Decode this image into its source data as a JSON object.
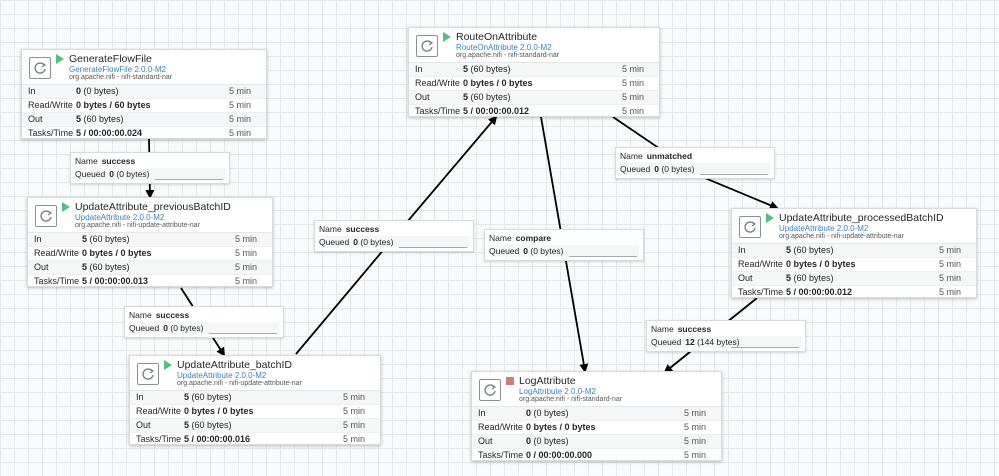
{
  "processors": {
    "gen": {
      "name": "GenerateFlowFile",
      "version": "GenerateFlowFile 2.0.0-M2",
      "bundle": "org.apache.nifi - nifi-standard-nar",
      "state": "running",
      "in_label": "In",
      "in_count": "0",
      "in_bytes": "(0 bytes)",
      "in_time": "5 min",
      "rw_label": "Read/Write",
      "rw_value": "0 bytes / 60 bytes",
      "rw_time": "5 min",
      "out_label": "Out",
      "out_count": "5",
      "out_bytes": "(60 bytes)",
      "out_time": "5 min",
      "tasks_label": "Tasks/Time",
      "tasks_value": "5 / 00:00:00.024",
      "tasks_time": "5 min"
    },
    "prev": {
      "name": "UpdateAttribute_previousBatchID",
      "version": "UpdateAttribute 2.0.0-M2",
      "bundle": "org.apache.nifi - nifi-update-attribute-nar",
      "state": "running",
      "in_label": "In",
      "in_count": "5",
      "in_bytes": "(60 bytes)",
      "in_time": "5 min",
      "rw_label": "Read/Write",
      "rw_value": "0 bytes / 0 bytes",
      "rw_time": "5 min",
      "out_label": "Out",
      "out_count": "5",
      "out_bytes": "(60 bytes)",
      "out_time": "5 min",
      "tasks_label": "Tasks/Time",
      "tasks_value": "5 / 00:00:00.013",
      "tasks_time": "5 min"
    },
    "batch": {
      "name": "UpdateAttribute_batchID",
      "version": "UpdateAttribute 2.0.0-M2",
      "bundle": "org.apache.nifi - nifi-update-attribute-nar",
      "state": "running",
      "in_label": "In",
      "in_count": "5",
      "in_bytes": "(60 bytes)",
      "in_time": "5 min",
      "rw_label": "Read/Write",
      "rw_value": "0 bytes / 0 bytes",
      "rw_time": "5 min",
      "out_label": "Out",
      "out_count": "5",
      "out_bytes": "(60 bytes)",
      "out_time": "5 min",
      "tasks_label": "Tasks/Time",
      "tasks_value": "5 / 00:00:00.016",
      "tasks_time": "5 min"
    },
    "route": {
      "name": "RouteOnAttribute",
      "version": "RouteOnAttribute 2.0.0-M2",
      "bundle": "org.apache.nifi - nifi-standard-nar",
      "state": "running",
      "in_label": "In",
      "in_count": "5",
      "in_bytes": "(60 bytes)",
      "in_time": "5 min",
      "rw_label": "Read/Write",
      "rw_value": "0 bytes / 0 bytes",
      "rw_time": "5 min",
      "out_label": "Out",
      "out_count": "5",
      "out_bytes": "(60 bytes)",
      "out_time": "5 min",
      "tasks_label": "Tasks/Time",
      "tasks_value": "5 / 00:00:00.012",
      "tasks_time": "5 min"
    },
    "processed": {
      "name": "UpdateAttribute_processedBatchID",
      "version": "UpdateAttribute 2.0.0-M2",
      "bundle": "org.apache.nifi - nifi-update-attribute-nar",
      "state": "running",
      "in_label": "In",
      "in_count": "5",
      "in_bytes": "(60 bytes)",
      "in_time": "5 min",
      "rw_label": "Read/Write",
      "rw_value": "0 bytes / 0 bytes",
      "rw_time": "5 min",
      "out_label": "Out",
      "out_count": "5",
      "out_bytes": "(60 bytes)",
      "out_time": "5 min",
      "tasks_label": "Tasks/Time",
      "tasks_value": "5 / 00:00:00.012",
      "tasks_time": "5 min"
    },
    "log": {
      "name": "LogAttribute",
      "version": "LogAttribute 2.0.0-M2",
      "bundle": "org.apache.nifi - nifi-standard-nar",
      "state": "stopped",
      "in_label": "In",
      "in_count": "0",
      "in_bytes": "(0 bytes)",
      "in_time": "5 min",
      "rw_label": "Read/Write",
      "rw_value": "0 bytes / 0 bytes",
      "rw_time": "5 min",
      "out_label": "Out",
      "out_count": "0",
      "out_bytes": "(0 bytes)",
      "out_time": "5 min",
      "tasks_label": "Tasks/Time",
      "tasks_value": "0 / 00:00:00.000",
      "tasks_time": "5 min"
    }
  },
  "connections": {
    "c1": {
      "name_label": "Name",
      "name": "success",
      "queued_label": "Queued",
      "queued_count": "0",
      "queued_bytes": "(0 bytes)"
    },
    "c2": {
      "name_label": "Name",
      "name": "success",
      "queued_label": "Queued",
      "queued_count": "0",
      "queued_bytes": "(0 bytes)"
    },
    "c3": {
      "name_label": "Name",
      "name": "success",
      "queued_label": "Queued",
      "queued_count": "0",
      "queued_bytes": "(0 bytes)"
    },
    "c4": {
      "name_label": "Name",
      "name": "compare",
      "queued_label": "Queued",
      "queued_count": "0",
      "queued_bytes": "(0 bytes)"
    },
    "c5": {
      "name_label": "Name",
      "name": "unmatched",
      "queued_label": "Queued",
      "queued_count": "0",
      "queued_bytes": "(0 bytes)"
    },
    "c6": {
      "name_label": "Name",
      "name": "success",
      "queued_label": "Queued",
      "queued_count": "12",
      "queued_bytes": "(144 bytes)"
    }
  },
  "colors": {
    "running": "#52bf7e",
    "stopped": "#cc7c7c",
    "version_link": "#3b82b8",
    "canvas_bg": "#f9fafb",
    "grid": "#e3e8eb"
  },
  "icons": {
    "processor": "processor-icon",
    "running": "run-status-icon",
    "stopped": "stop-status-icon"
  }
}
